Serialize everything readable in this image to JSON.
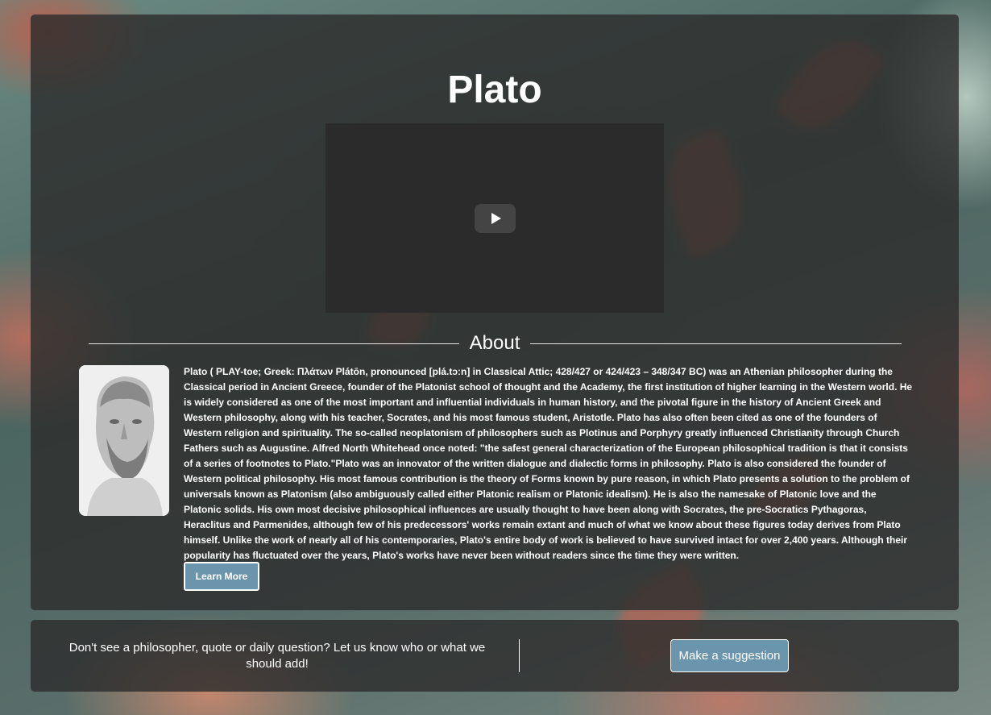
{
  "page": {
    "title": "Plato",
    "about_heading": "About",
    "bio": "Plato ( PLAY-toe; Greek: Πλάτων Plátōn, pronounced [plá.tɔːn] in Classical Attic; 428/427 or 424/423 – 348/347 BC) was an Athenian philosopher during the Classical period in Ancient Greece, founder of the Platonist school of thought and the Academy, the first institution of higher learning in the Western world. He is widely considered as one of the most important and influential individuals in human history, and the pivotal figure in the history of Ancient Greek and Western philosophy, along with his teacher, Socrates, and his most famous student, Aristotle. Plato has also often been cited as one of the founders of Western religion and spirituality. The so-called neoplatonism of philosophers such as Plotinus and Porphyry greatly influenced Christianity through Church Fathers such as Augustine. Alfred North Whitehead once noted: \"the safest general characterization of the European philosophical tradition is that it consists of a series of footnotes to Plato.\"Plato was an innovator of the written dialogue and dialectic forms in philosophy. Plato is also considered the founder of Western political philosophy. His most famous contribution is the theory of Forms known by pure reason, in which Plato presents a solution to the problem of universals known as Platonism (also ambiguously called either Platonic realism or Platonic idealism). He is also the namesake of Platonic love and the Platonic solids. His own most decisive philosophical influences are usually thought to have been along with Socrates, the pre-Socratics Pythagoras, Heraclitus and Parmenides, although few of his predecessors' works remain extant and much of what we know about these figures today derives from Plato himself. Unlike the work of nearly all of his contemporaries, Plato's entire body of work is believed to have survived intact for over 2,400 years. Although their popularity has fluctuated over the years, Plato's works have never been without readers since the time they were written.",
    "learn_more_label": "Learn More"
  },
  "video": {
    "play_icon": "play-icon"
  },
  "footer": {
    "prompt": "Don't see a philosopher, quote or daily question? Let us know who or what we should add!",
    "suggest_label": "Make a suggestion"
  },
  "colors": {
    "button_bg": "#6b94ad",
    "card_bg": "rgba(45,45,45,0.82)"
  }
}
